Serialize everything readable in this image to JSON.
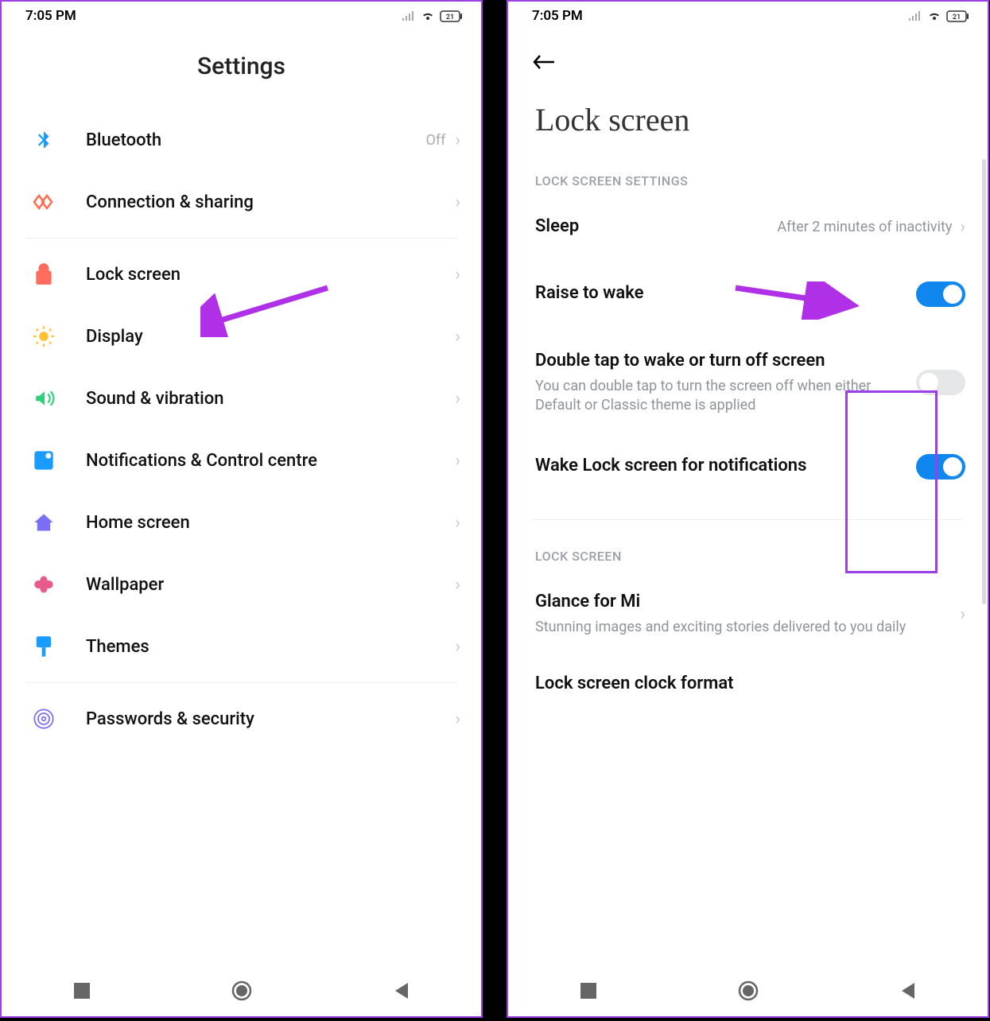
{
  "status": {
    "time": "7:05 PM",
    "battery": "21"
  },
  "left": {
    "title": "Settings",
    "rows": [
      {
        "label": "Bluetooth",
        "trailing": "Off",
        "icon": "bluetooth"
      },
      {
        "label": "Connection & sharing",
        "icon": "connection"
      },
      {
        "divider": true
      },
      {
        "label": "Lock screen",
        "icon": "lock"
      },
      {
        "label": "Display",
        "icon": "display"
      },
      {
        "label": "Sound & vibration",
        "icon": "sound"
      },
      {
        "label": "Notifications & Control centre",
        "icon": "notifications"
      },
      {
        "label": "Home screen",
        "icon": "home"
      },
      {
        "label": "Wallpaper",
        "icon": "wallpaper"
      },
      {
        "label": "Themes",
        "icon": "themes"
      },
      {
        "divider": true
      },
      {
        "label": "Passwords & security",
        "icon": "security"
      }
    ]
  },
  "right": {
    "title": "Lock screen",
    "sections": [
      {
        "header": "LOCK SCREEN SETTINGS",
        "items": [
          {
            "title": "Sleep",
            "value": "After 2 minutes of inactivity",
            "type": "link"
          },
          {
            "title": "Raise to wake",
            "type": "toggle",
            "on": true
          },
          {
            "title": "Double tap to wake or turn off screen",
            "subtitle": "You can double tap to turn the screen off when either Default or Classic theme is applied",
            "type": "toggle",
            "on": false
          },
          {
            "title": "Wake Lock screen for notifications",
            "type": "toggle",
            "on": true
          }
        ]
      },
      {
        "header": "LOCK SCREEN",
        "items": [
          {
            "title": "Glance for Mi",
            "subtitle": "Stunning images and exciting stories delivered to you daily",
            "type": "link"
          },
          {
            "title": "Lock screen clock format",
            "type": "link-nochevron"
          }
        ]
      }
    ]
  }
}
